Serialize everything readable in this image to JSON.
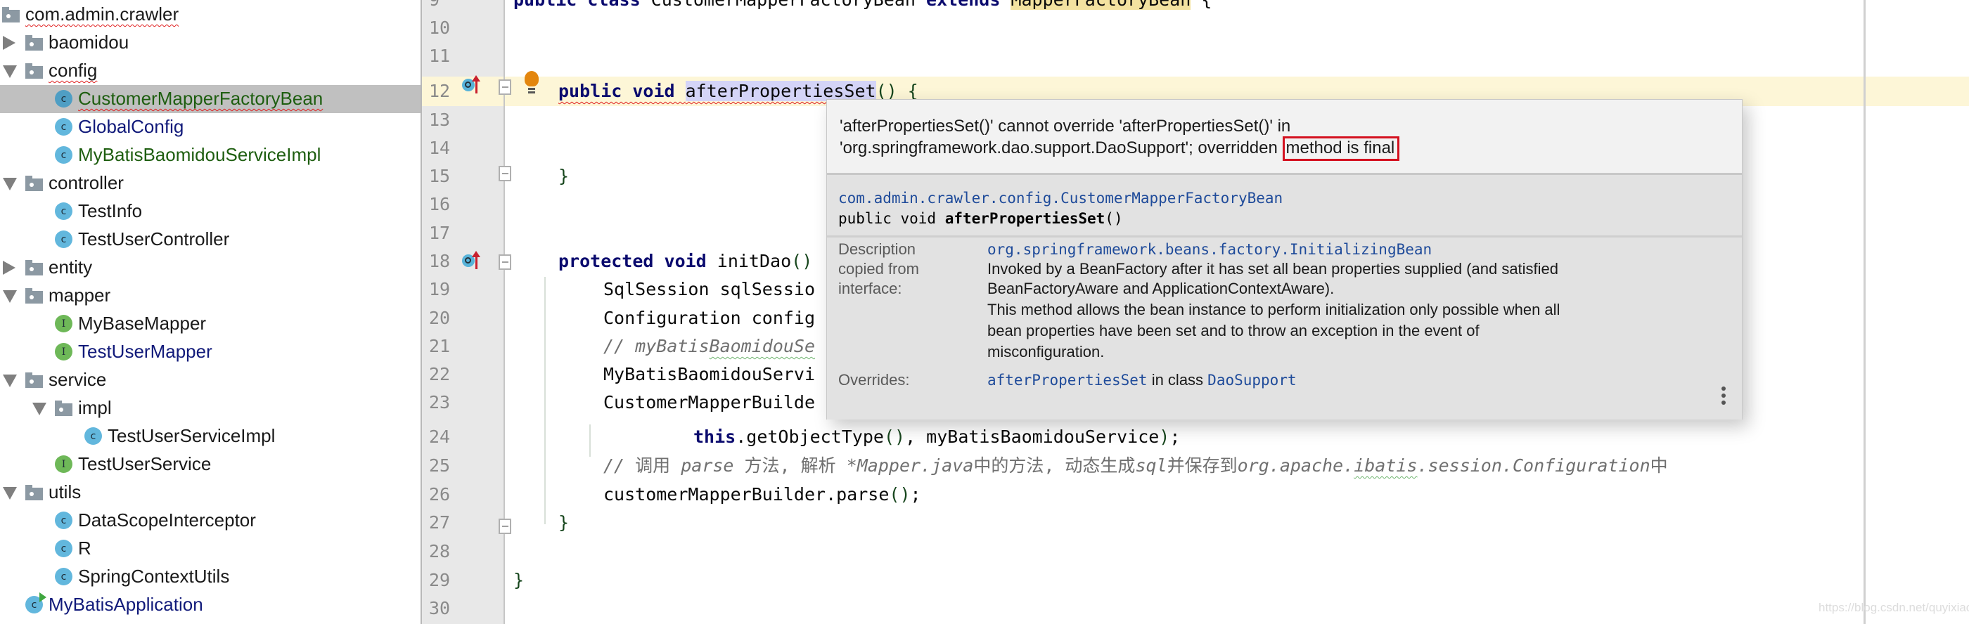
{
  "project_tree": {
    "items": [
      {
        "label": "com.admin.crawler",
        "kind": "package",
        "arrow": "none",
        "depth": 0,
        "color": "default",
        "error": true
      },
      {
        "label": "baomidou",
        "kind": "folder",
        "arrow": "collapsed",
        "depth": 1,
        "color": "default",
        "error": false
      },
      {
        "label": "config",
        "kind": "folder",
        "arrow": "expanded",
        "depth": 1,
        "color": "default",
        "error": true
      },
      {
        "label": "CustomerMapperFactoryBean",
        "kind": "class",
        "arrow": "none",
        "depth": 2,
        "color": "green",
        "error": true,
        "selected": true
      },
      {
        "label": "GlobalConfig",
        "kind": "class",
        "arrow": "none",
        "depth": 2,
        "color": "navy",
        "error": false
      },
      {
        "label": "MyBatisBaomidouServiceImpl",
        "kind": "class",
        "arrow": "none",
        "depth": 2,
        "color": "green",
        "error": false
      },
      {
        "label": "controller",
        "kind": "folder",
        "arrow": "expanded",
        "depth": 1,
        "color": "default",
        "error": false
      },
      {
        "label": "TestInfo",
        "kind": "class",
        "arrow": "none",
        "depth": 2,
        "color": "default",
        "error": false
      },
      {
        "label": "TestUserController",
        "kind": "class",
        "arrow": "none",
        "depth": 2,
        "color": "default",
        "error": false
      },
      {
        "label": "entity",
        "kind": "folder",
        "arrow": "collapsed",
        "depth": 1,
        "color": "default",
        "error": false
      },
      {
        "label": "mapper",
        "kind": "folder",
        "arrow": "expanded",
        "depth": 1,
        "color": "default",
        "error": false
      },
      {
        "label": "MyBaseMapper",
        "kind": "interface",
        "arrow": "none",
        "depth": 2,
        "color": "default",
        "error": false
      },
      {
        "label": "TestUserMapper",
        "kind": "interface",
        "arrow": "none",
        "depth": 2,
        "color": "navy",
        "error": false
      },
      {
        "label": "service",
        "kind": "folder",
        "arrow": "expanded",
        "depth": 1,
        "color": "default",
        "error": false
      },
      {
        "label": "impl",
        "kind": "folder",
        "arrow": "expanded",
        "depth": 2,
        "color": "default",
        "error": false
      },
      {
        "label": "TestUserServiceImpl",
        "kind": "class",
        "arrow": "none",
        "depth": 3,
        "color": "default",
        "error": false
      },
      {
        "label": "TestUserService",
        "kind": "interface",
        "arrow": "none",
        "depth": 2,
        "color": "default",
        "error": false
      },
      {
        "label": "utils",
        "kind": "folder",
        "arrow": "expanded",
        "depth": 1,
        "color": "default",
        "error": false
      },
      {
        "label": "DataScopeInterceptor",
        "kind": "class",
        "arrow": "none",
        "depth": 2,
        "color": "default",
        "error": false
      },
      {
        "label": "R",
        "kind": "class",
        "arrow": "none",
        "depth": 2,
        "color": "default",
        "error": false
      },
      {
        "label": "SpringContextUtils",
        "kind": "class",
        "arrow": "none",
        "depth": 2,
        "color": "default",
        "error": false
      },
      {
        "label": "MyBatisApplication",
        "kind": "application",
        "arrow": "none",
        "depth": 1,
        "color": "navy",
        "error": false
      }
    ],
    "class_icon_letter": "c",
    "interface_icon_letter": "I"
  },
  "editor": {
    "line_numbers": [
      "9",
      "10",
      "11",
      "12",
      "13",
      "14",
      "15",
      "16",
      "17",
      "18",
      "19",
      "20",
      "21",
      "22",
      "23",
      "24",
      "25",
      "26",
      "27",
      "28",
      "29",
      "30"
    ],
    "current_line": "12",
    "lines": {
      "l9": {
        "kw1": "public class ",
        "name": "CustomerMapperFactoryBean ",
        "kw2": "extends ",
        "parent": "MapperFactoryBean",
        "rest": " {"
      },
      "l12": {
        "kw": "public void ",
        "method": "afterPropertiesSet",
        "parens": "()",
        "rest": " {"
      },
      "l15": {
        "text": "}"
      },
      "l18": {
        "kw": "protected void ",
        "method": "initDao",
        "parens": "()"
      },
      "l19": {
        "text": "SqlSession sqlSessio"
      },
      "l20": {
        "text": "Configuration config"
      },
      "l21": {
        "prefix": "// myBatis",
        "squiggled": "BaomidouSe",
        "rest": ""
      },
      "l22": {
        "text": "MyBatisBaomidouServi"
      },
      "l23": {
        "text": "CustomerMapperBuilde"
      },
      "l24": {
        "kw": "this",
        "call": ".getObjectType",
        "open": "(",
        "close": ")",
        "rest": ", myBatisBaomidouService",
        "close2": ")",
        "end": ";"
      },
      "l25": {
        "c1": "// ",
        "c2": "调用 ",
        "c3": "parse",
        "c4": " 方法, 解析 ",
        "c5": "*Mapper.java",
        "c6": "中的方法, 动态生成",
        "c7": "sql",
        "c8": "并保存到",
        "c9": "org.apache.",
        "c10": "ibatis",
        "c11": ".session.Configuration",
        "c12": "中"
      },
      "l26": {
        "text": "customerMapperBuilder.parse",
        "parens": "()",
        "end": ";"
      },
      "l27": {
        "text": "}"
      },
      "l29": {
        "text": "}"
      }
    }
  },
  "popup": {
    "error_line1": "'afterPropertiesSet()' cannot override 'afterPropertiesSet()' in",
    "error_line2_prefix": "'org.springframework.dao.support.DaoSupport'; overridden ",
    "error_line2_highlight": "method is final",
    "decl_class": "com.admin.crawler.config.CustomerMapperFactoryBean",
    "decl_sig_prefix": "public void ",
    "decl_sig_method": "afterPropertiesSet",
    "decl_sig_suffix": "()",
    "desc_key_1": "Description",
    "desc_key_2": "copied from",
    "desc_key_3": "interface:",
    "desc_link": "org.springframework.beans.factory.InitializingBean",
    "desc_lines": [
      "Invoked by a BeanFactory after it has set all bean properties supplied (and satisfied",
      "BeanFactoryAware and ApplicationContextAware).",
      "This method allows the bean instance to perform initialization only possible when all",
      "bean properties have been set and to throw an exception in the event of",
      "misconfiguration."
    ],
    "overrides_key": "Overrides:",
    "overrides_method": "afterPropertiesSet",
    "overrides_mid": " in class ",
    "overrides_class": "DaoSupport"
  },
  "watermark": "https://blog.csdn.net/quyixiao",
  "colors": {
    "selection": "#c0c0c0",
    "current_line": "#fdf6d7",
    "error_box": "#d4111f",
    "link": "#1f4b9a",
    "keyword": "#0a0a6e"
  }
}
